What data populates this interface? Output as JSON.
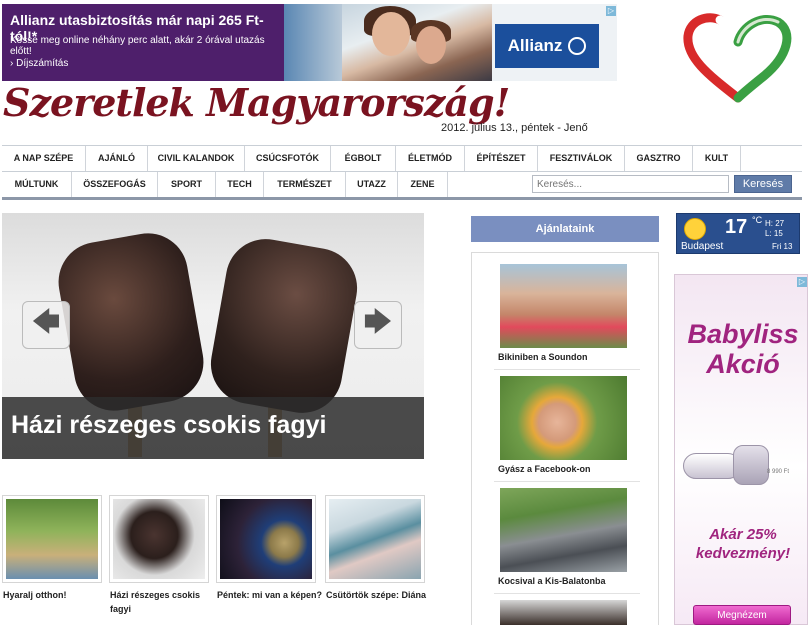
{
  "ad_top": {
    "headline": "Allianz utasbiztosítás már napi 265 Ft-tól!*",
    "subline": "Kösse meg online néhány perc alatt, akár 2 órával utazás előtt!",
    "cta": "› Díjszámítás",
    "brand": "Allianz",
    "adchoices": "▷"
  },
  "header": {
    "site_title": "Szeretlek Magyarország!",
    "date": "2012. július 13., péntek - Jenő"
  },
  "nav": {
    "row1": [
      "A NAP SZÉPE",
      "AJÁNLÓ",
      "CIVIL KALANDOK",
      "CSÚCSFOTÓK",
      "ÉGBOLT",
      "ÉLETMÓD",
      "ÉPÍTÉSZET",
      "FESZTIVÁLOK",
      "GASZTRO",
      "KULT"
    ],
    "row2": [
      "MÚLTUNK",
      "ÖSSZEFOGÁS",
      "SPORT",
      "TECH",
      "TERMÉSZET",
      "UTAZZ",
      "ZENE"
    ],
    "search_placeholder": "Keresés...",
    "search_button": "Keresés"
  },
  "slider": {
    "caption": "Házi részeges csokis fagyi",
    "prev_arrow": "🡄",
    "next_arrow": "🡆"
  },
  "thumbnails": [
    {
      "label": "Hyaralj otthon!"
    },
    {
      "label": "Házi részeges csokis fagyi"
    },
    {
      "label": "Péntek: mi van a képen?"
    },
    {
      "label": "Csütörtök szépe: Diána"
    }
  ],
  "ajanlataink": {
    "title": "Ajánlataink",
    "items": [
      {
        "label": "Bikiniben a Soundon"
      },
      {
        "label": "Gyász a Facebook-on"
      },
      {
        "label": "Kocsival a Kis-Balatonba"
      }
    ]
  },
  "weather": {
    "temp": "17",
    "unit": "°C",
    "high": "H: 27",
    "low": "L: 15",
    "city": "Budapest",
    "day": "Fri 13"
  },
  "ad_right": {
    "title": "Babyliss Akció",
    "offer": "Akár 25% kedvezmény!",
    "price": "8 990 Ft",
    "button": "Megnézem",
    "adchoices": "▷"
  }
}
